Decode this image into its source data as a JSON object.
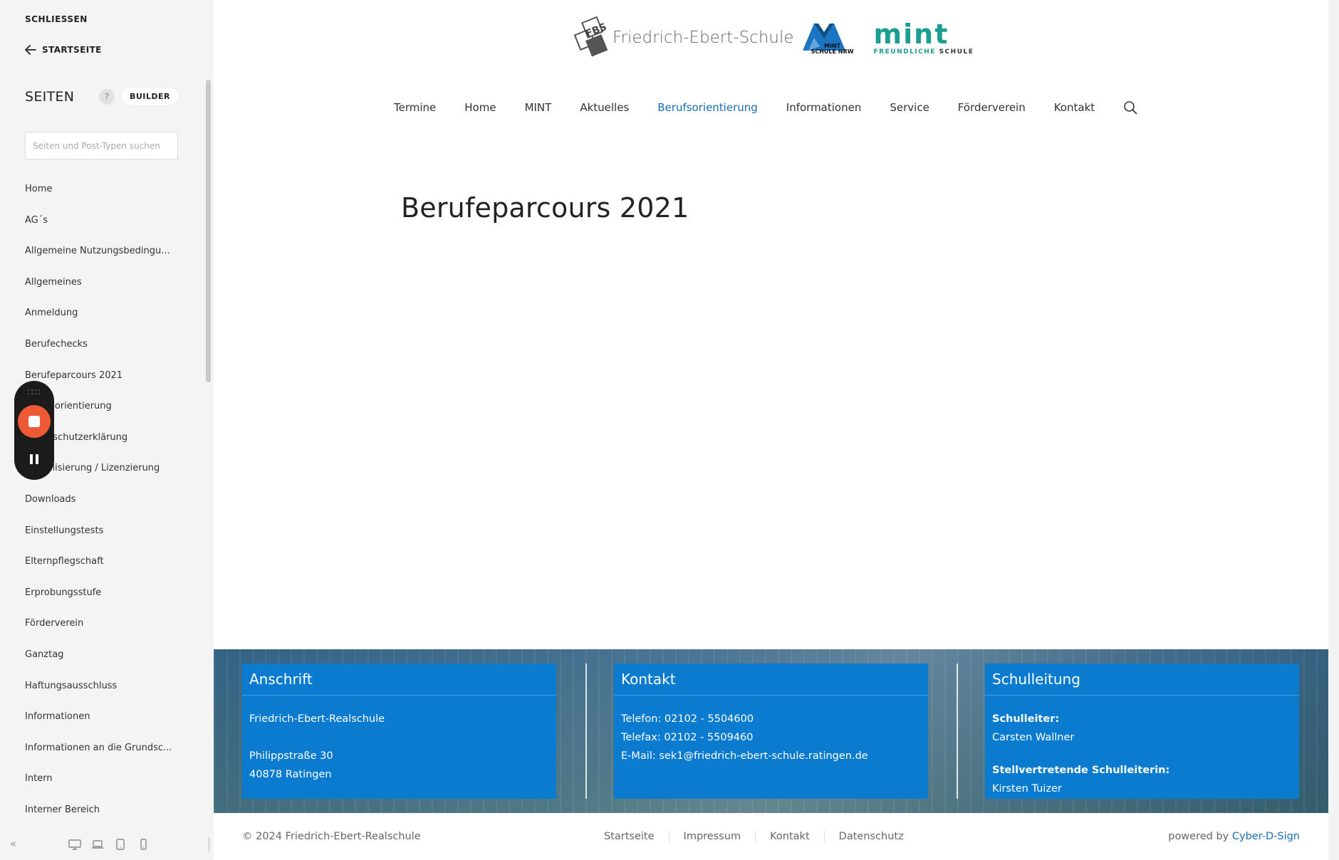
{
  "sidebar": {
    "close_label": "SCHLIESSEN",
    "home_label": "STARTSEITE",
    "section_title": "SEITEN",
    "help_label": "?",
    "builder_label": "BUILDER",
    "search_placeholder": "Seiten und Post-Typen suchen",
    "collapse_label": "«",
    "pages": [
      "Home",
      "AG´s",
      "Allgemeine Nutzungsbedingu...",
      "Allgemeines",
      "Anmeldung",
      "Berufechecks",
      "Berufeparcours 2021",
      "Berufsorientierung",
      "Datenschutzerklärung",
      "Digitalisierung / Lizenzierung",
      "Downloads",
      "Einstellungstests",
      "Elternpflegschaft",
      "Erprobungsstufe",
      "Förderverein",
      "Ganztag",
      "Haftungsausschluss",
      "Informationen",
      "Informationen an die Grundsc...",
      "Intern",
      "Interner Bereich"
    ],
    "active_page_index": 6
  },
  "recorder": {
    "grip": "::::"
  },
  "header": {
    "logo_text": "FBS",
    "school_name": "Friedrich-Ebert-Schule",
    "mint_nrw_text": "MINT SCHULE NRW",
    "mint_word": "mint",
    "mint_sub": "FREUNDLICHE",
    "mint_sub_bold": "SCHULE"
  },
  "nav": {
    "items": [
      "Termine",
      "Home",
      "MINT",
      "Aktuelles",
      "Berufsorientierung",
      "Informationen",
      "Service",
      "Förderverein",
      "Kontakt"
    ],
    "current_index": 4
  },
  "page": {
    "title": "Berufeparcours 2021"
  },
  "footer": {
    "anschrift": {
      "title": "Anschrift",
      "line1": "Friedrich-Ebert-Realschule",
      "line2": "Philippstraße 30",
      "line3": "40878 Ratingen"
    },
    "kontakt": {
      "title": "Kontakt",
      "line1": "Telefon: 02102 - 5504600",
      "line2": "Telefax: 02102 - 5509460",
      "line3": "E-Mail: sek1@friedrich-ebert-schule.ratingen.de"
    },
    "schulleitung": {
      "title": "Schulleitung",
      "label1": "Schulleiter:",
      "name1": "Carsten Wallner",
      "label2": "Stellvertretende Schulleiterin:",
      "name2": "Kirsten Tuizer"
    },
    "copyright": "© 2024 Friedrich-Ebert-Realschule",
    "links": [
      "Startseite",
      "Impressum",
      "Kontakt",
      "Datenschutz"
    ],
    "powered_prefix": "powered by",
    "powered_link": "Cyber-D-Sign"
  },
  "colors": {
    "accent": "#1a6fb5",
    "footer_box": "#0a7bcf",
    "mint": "#1a9e8f",
    "recorder_stop": "#ee5a36"
  }
}
